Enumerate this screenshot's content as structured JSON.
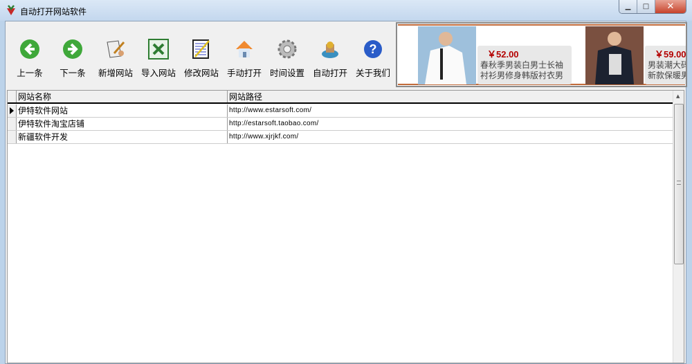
{
  "window": {
    "title": "自动打开网站软件"
  },
  "toolbar": [
    {
      "label": "上一条",
      "icon": "arrow-left-icon"
    },
    {
      "label": "下一条",
      "icon": "arrow-right-icon"
    },
    {
      "label": "新增网站",
      "icon": "scroll-pen-icon"
    },
    {
      "label": "导入网站",
      "icon": "excel-icon"
    },
    {
      "label": "修改网站",
      "icon": "edit-document-icon"
    },
    {
      "label": "手动打开",
      "icon": "home-icon"
    },
    {
      "label": "时间设置",
      "icon": "gear-icon"
    },
    {
      "label": "自动打开",
      "icon": "auto-house-icon"
    },
    {
      "label": "关于我们",
      "icon": "help-icon"
    }
  ],
  "ads": [
    {
      "price": "￥52.00",
      "line1": "春秋季男装白男士长袖",
      "line2": "衬衫男修身韩版衬衣男"
    },
    {
      "price": "￥59.00",
      "line1": "男装潮大码棉衣",
      "line2": "新款保暖男士秋"
    }
  ],
  "grid": {
    "columns": [
      "网站名称",
      "网站路径"
    ],
    "rows": [
      {
        "name": "伊特软件网站",
        "url": "http://www.estarsoft.com/"
      },
      {
        "name": "伊特软件淘宝店铺",
        "url": "http://estarsoft.taobao.com/"
      },
      {
        "name": "新疆软件开发",
        "url": "http://www.xjrjkf.com/"
      }
    ]
  }
}
